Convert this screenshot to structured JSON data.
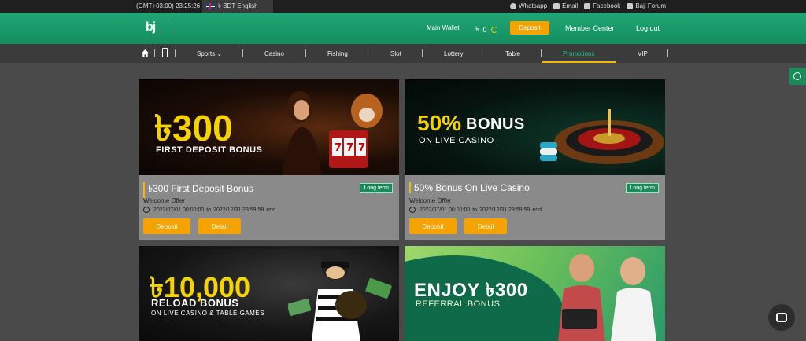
{
  "topbar": {
    "time": "(GMT+03:00) 23:25:26",
    "language": "৳ BDT English",
    "links": [
      "Whatsapp",
      "Email",
      "Facebook",
      "Baji Forum"
    ]
  },
  "header": {
    "logo": "bj",
    "main_wallet": "Main Wallet",
    "currency": "৳",
    "balance": "0",
    "deposit": "Deposit",
    "member_center": "Member Center",
    "logout": "Log out"
  },
  "nav": {
    "items": [
      "Sports",
      "Casino",
      "Fishing",
      "Slot",
      "Lottery",
      "Table",
      "Promotions",
      "VIP"
    ],
    "active": "Promotions"
  },
  "cards": [
    {
      "title": "৳300 First Deposit Bonus",
      "badge": "Long term",
      "category": "Welcome Offer",
      "start": "2022/07/01 00:00:00",
      "to": "to",
      "end": "2022/12/31 23:59:59",
      "end_label": "end",
      "deposit": "Deposit",
      "detail": "Detail",
      "banner_big": "৳300",
      "banner_sub": "FIRST DEPOSIT BONUS"
    },
    {
      "title": "50% Bonus On Live Casino",
      "badge": "Long term",
      "category": "Welcome Offer",
      "start": "2022/07/01 00:00:00",
      "to": "to",
      "end": "2022/12/31 23:59:59",
      "end_label": "end",
      "deposit": "Deposit",
      "detail": "Detail",
      "banner_big": "50%",
      "banner_big2": "BONUS",
      "banner_sub": "ON LIVE CASINO"
    },
    {
      "banner_big": "৳10,000",
      "banner_sub": "RELOAD BONUS",
      "banner_sub2": "ON LIVE CASINO & TABLE GAMES"
    },
    {
      "banner_big": "ENJOY ৳300",
      "banner_sub": "REFERRAL BONUS"
    }
  ],
  "colors": {
    "brand_green": "#1a9a6a",
    "accent_yellow": "#f5a300",
    "active_nav": "#21c48a"
  }
}
